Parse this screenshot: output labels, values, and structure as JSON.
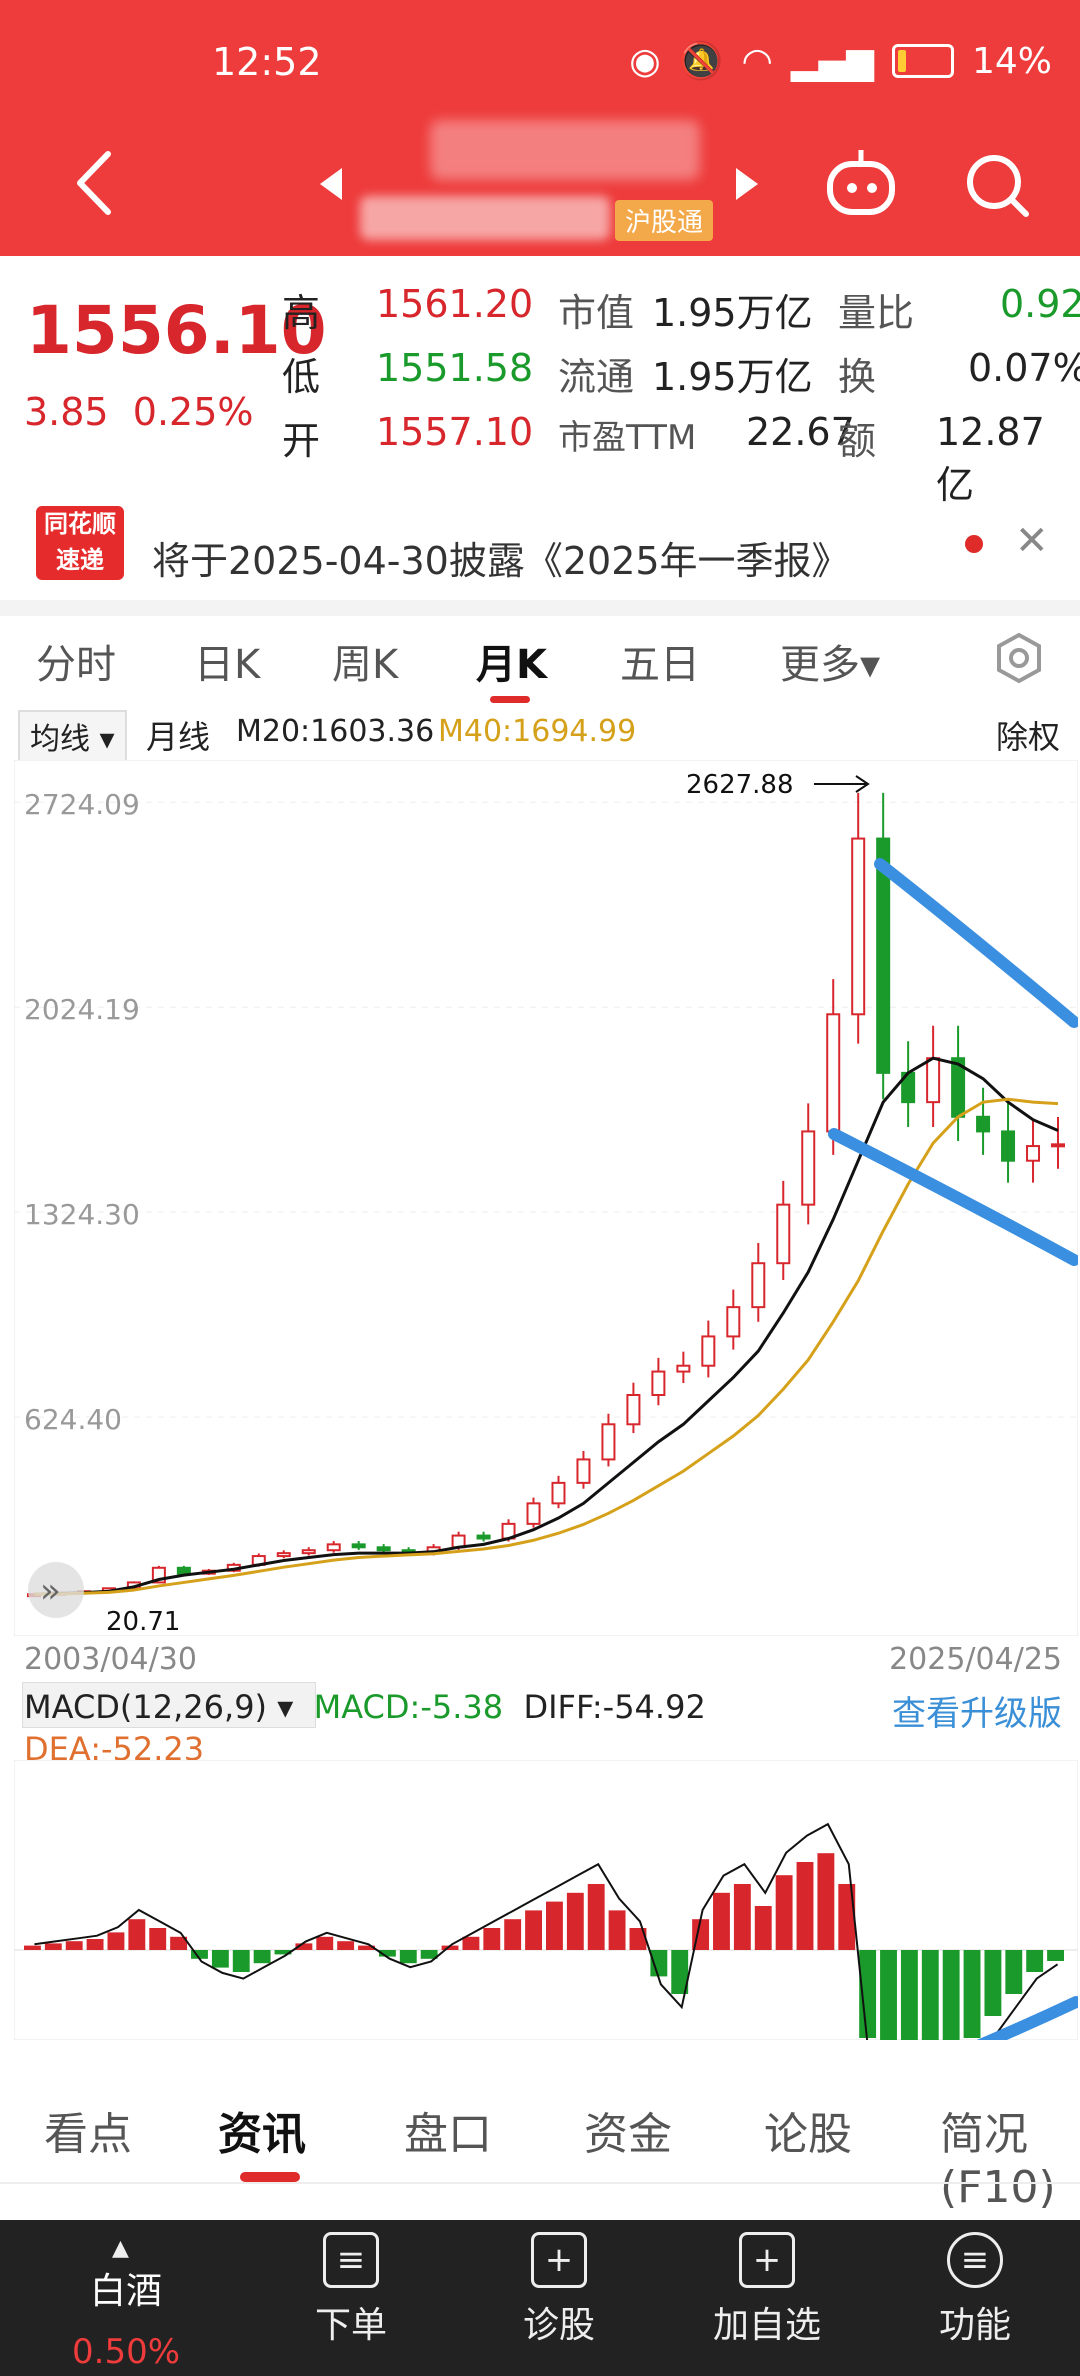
{
  "status": {
    "time": "12:52",
    "battery": "14%"
  },
  "header": {
    "tag": "沪股通"
  },
  "quote": {
    "price": "1556.10",
    "change": "3.85",
    "change_pct": "0.25%",
    "high_label": "高",
    "high": "1561.20",
    "low_label": "低",
    "low": "1551.58",
    "open_label": "开",
    "open": "1557.10",
    "mktcap_label": "市值",
    "mktcap": "1.95万亿",
    "float_label": "流通",
    "float": "1.95万亿",
    "pe_label": "市盈TTM",
    "pe": "22.67",
    "vr_label": "量比",
    "vr": "0.92",
    "turnover_label": "换",
    "turnover": "0.07%",
    "amount_label": "额",
    "amount": "12.87亿"
  },
  "notice": {
    "logo_top": "同花顺",
    "logo_bottom": "速递",
    "text": "将于2025-04-30披露《2025年一季报》"
  },
  "period_tabs": [
    "分时",
    "日K",
    "周K",
    "月K",
    "五日",
    "更多▾"
  ],
  "ma": {
    "selector": "均线 ▾",
    "name": "月线",
    "m20": "M20:1603.36",
    "m40": "M40:1694.99",
    "adjust": "除权"
  },
  "chart_data": {
    "type": "candlestick",
    "y_ticks": [
      "2724.09",
      "2024.19",
      "1324.30",
      "624.40"
    ],
    "max_label": "2627.88",
    "min_label": "20.71",
    "x_start": "2003/04/30",
    "x_end": "2025/04/25",
    "ylim": [
      0,
      2800
    ],
    "close_approx": [
      20,
      25,
      30,
      40,
      60,
      110,
      90,
      100,
      120,
      150,
      160,
      170,
      190,
      180,
      170,
      160,
      180,
      220,
      210,
      260,
      330,
      400,
      480,
      600,
      700,
      780,
      800,
      900,
      1000,
      1150,
      1350,
      1600,
      2000,
      2600,
      1800,
      1700,
      1850,
      1650,
      1600,
      1500,
      1550,
      1556
    ],
    "ma20_approx": [
      20,
      22,
      25,
      30,
      45,
      70,
      85,
      95,
      105,
      120,
      135,
      145,
      155,
      160,
      160,
      160,
      165,
      180,
      190,
      210,
      240,
      280,
      330,
      400,
      470,
      540,
      600,
      680,
      760,
      850,
      980,
      1120,
      1300,
      1500,
      1700,
      1800,
      1850,
      1830,
      1780,
      1700,
      1640,
      1603
    ],
    "ma40_approx": [
      20,
      21,
      23,
      26,
      34,
      48,
      60,
      72,
      84,
      98,
      112,
      124,
      136,
      145,
      150,
      154,
      158,
      166,
      174,
      186,
      204,
      228,
      258,
      296,
      340,
      390,
      440,
      500,
      560,
      630,
      720,
      820,
      950,
      1090,
      1260,
      1420,
      1560,
      1650,
      1700,
      1710,
      1700,
      1695
    ]
  },
  "macd": {
    "selector": "MACD(12,26,9) ▾",
    "macd": "MACD:-5.38",
    "diff": "DIFF:-54.92",
    "dea": "DEA:-52.23",
    "upgrade": "查看升级版",
    "bars_approx": [
      2,
      3,
      4,
      5,
      8,
      14,
      10,
      6,
      -4,
      -8,
      -10,
      -6,
      -2,
      3,
      6,
      4,
      2,
      -3,
      -6,
      -4,
      2,
      6,
      10,
      14,
      18,
      22,
      26,
      30,
      18,
      10,
      -12,
      -20,
      14,
      26,
      30,
      20,
      34,
      40,
      44,
      30,
      -40,
      -50,
      -46,
      -55,
      -48,
      -40,
      -30,
      -20,
      -10,
      -5
    ]
  },
  "bottom_tabs": [
    "看点",
    "资讯",
    "盘口",
    "资金",
    "论股",
    "简况(F10)"
  ],
  "bottom_nav": {
    "sector": "白酒",
    "sector_pct": "0.50%",
    "items": [
      "下单",
      "诊股",
      "加自选",
      "功能"
    ]
  }
}
